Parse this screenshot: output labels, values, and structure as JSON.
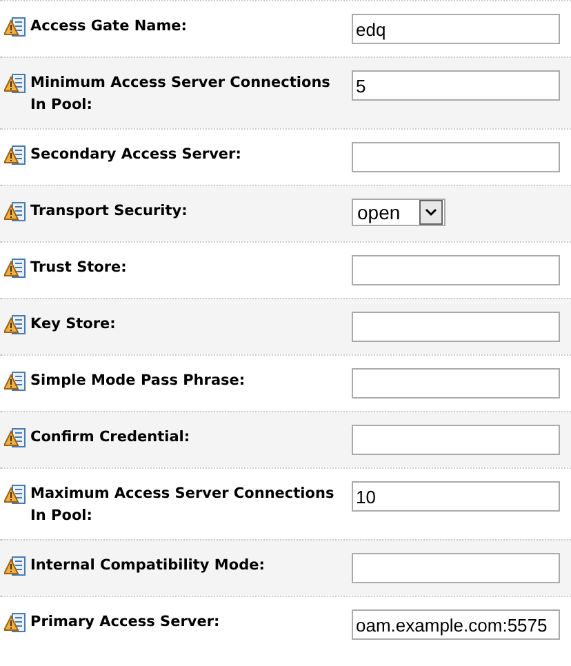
{
  "fields": [
    {
      "label": "Access Gate Name:",
      "kind": "text",
      "value": "edq"
    },
    {
      "label": "Minimum Access Server Connections In Pool:",
      "kind": "text",
      "value": "5"
    },
    {
      "label": "Secondary Access Server:",
      "kind": "text"
    },
    {
      "label": "Transport Security:",
      "kind": "select",
      "value": "open"
    },
    {
      "label": "Trust Store:",
      "kind": "text"
    },
    {
      "label": "Key Store:",
      "kind": "text"
    },
    {
      "label": "Simple Mode Pass Phrase:",
      "kind": "text"
    },
    {
      "label": "Confirm Credential:",
      "kind": "text"
    },
    {
      "label": "Maximum Access Server Connections In Pool:",
      "kind": "text",
      "value": "10"
    },
    {
      "label": "Internal Compatibility Mode:",
      "kind": "text"
    },
    {
      "label": "Primary Access Server:",
      "kind": "text",
      "value": "oam.example.com:5575"
    }
  ]
}
